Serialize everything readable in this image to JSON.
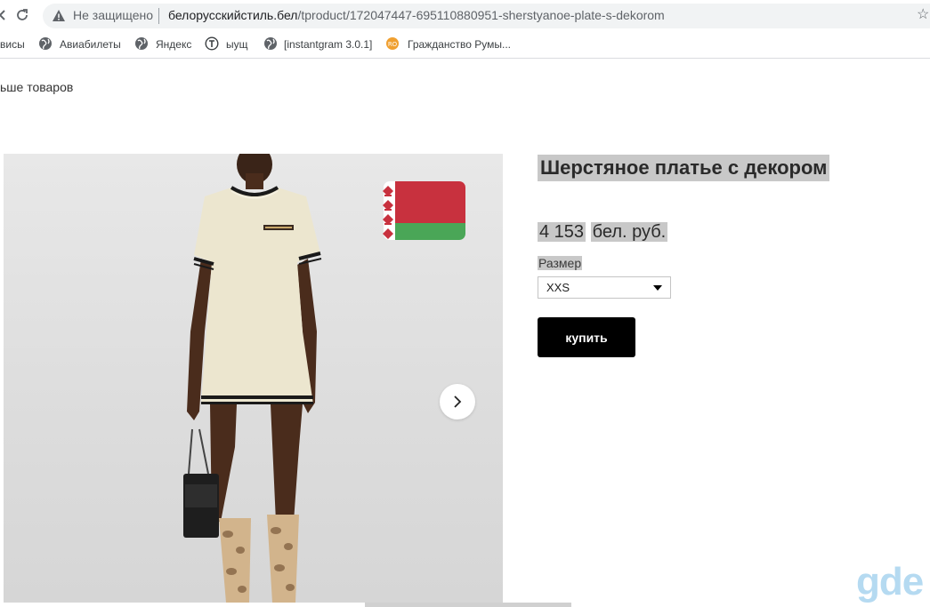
{
  "browser": {
    "security_label": "Не защищено",
    "url_host": "белорусскийстиль.бел",
    "url_path": "/tproduct/172047447-695110880951-sherstyanoe-plate-s-dekorom"
  },
  "bookmarks": [
    {
      "label": "висы",
      "icon": "none"
    },
    {
      "label": "Авиабилеты",
      "icon": "globe-icon"
    },
    {
      "label": "Яндекс",
      "icon": "globe-icon"
    },
    {
      "label": "ыущ",
      "icon": "t-circle-icon"
    },
    {
      "label": "[instantgram 3.0.1]",
      "icon": "globe-icon"
    },
    {
      "label": "Гражданство Румы...",
      "icon": "site-icon"
    }
  ],
  "page": {
    "more_products": "ьше товаров"
  },
  "product": {
    "title": "Шерстяное платье с декором",
    "price_value": "4 153",
    "price_currency": "бел. руб.",
    "size_label": "Размер",
    "size_selected": "XXS",
    "buy_label": "купить"
  },
  "flag": {
    "red": "#c8313e",
    "green": "#4aa657",
    "ornament": "#c8313e"
  },
  "watermark": "gde"
}
